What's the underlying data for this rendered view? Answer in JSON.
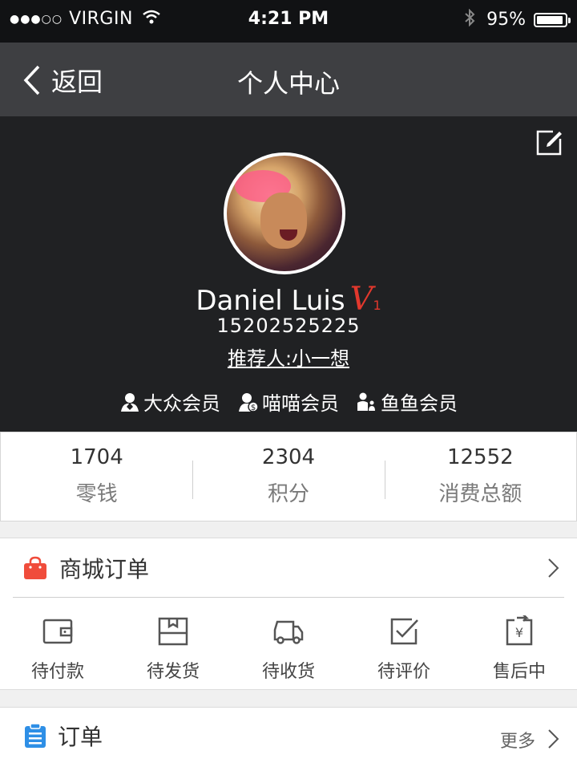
{
  "status_bar": {
    "signal_dots": "●●●○○",
    "carrier": "VIRGIN",
    "time": "4:21 PM",
    "battery": "95%",
    "battery_level": 0.95,
    "icons": [
      "wifi-icon",
      "bluetooth-icon",
      "battery-icon"
    ]
  },
  "navbar": {
    "back_label": "返回",
    "title": "个人中心"
  },
  "profile": {
    "name": "Daniel Luis",
    "vip_mark": "V",
    "vip_level": "1",
    "phone": "15202525225",
    "referrer": "推荐人:小一想",
    "badges": [
      {
        "label": "大众会员",
        "icon": "user-pin-icon"
      },
      {
        "label": "喵喵会员",
        "icon": "user-coin-icon"
      },
      {
        "label": "鱼鱼会员",
        "icon": "user-group-icon"
      }
    ]
  },
  "stats": [
    {
      "value": "1704",
      "label": "零钱"
    },
    {
      "value": "2304",
      "label": "积分"
    },
    {
      "value": "12552",
      "label": "消费总额"
    }
  ],
  "shop_orders": {
    "title": "商城订单",
    "items": [
      {
        "label": "待付款",
        "icon": "wallet-icon"
      },
      {
        "label": "待发货",
        "icon": "box-icon"
      },
      {
        "label": "待收货",
        "icon": "truck-icon"
      },
      {
        "label": "待评价",
        "icon": "check-square-icon"
      },
      {
        "label": "售后中",
        "icon": "refund-icon"
      }
    ]
  },
  "orders": {
    "title": "订单",
    "more": "更多"
  },
  "colors": {
    "status_bar_bg": "#111214",
    "navbar_bg": "#3e3f42",
    "profile_bg": "#202123",
    "vip_red": "#e2382d",
    "bag_red": "#f04c3b",
    "list_blue": "#2e8fe6"
  }
}
